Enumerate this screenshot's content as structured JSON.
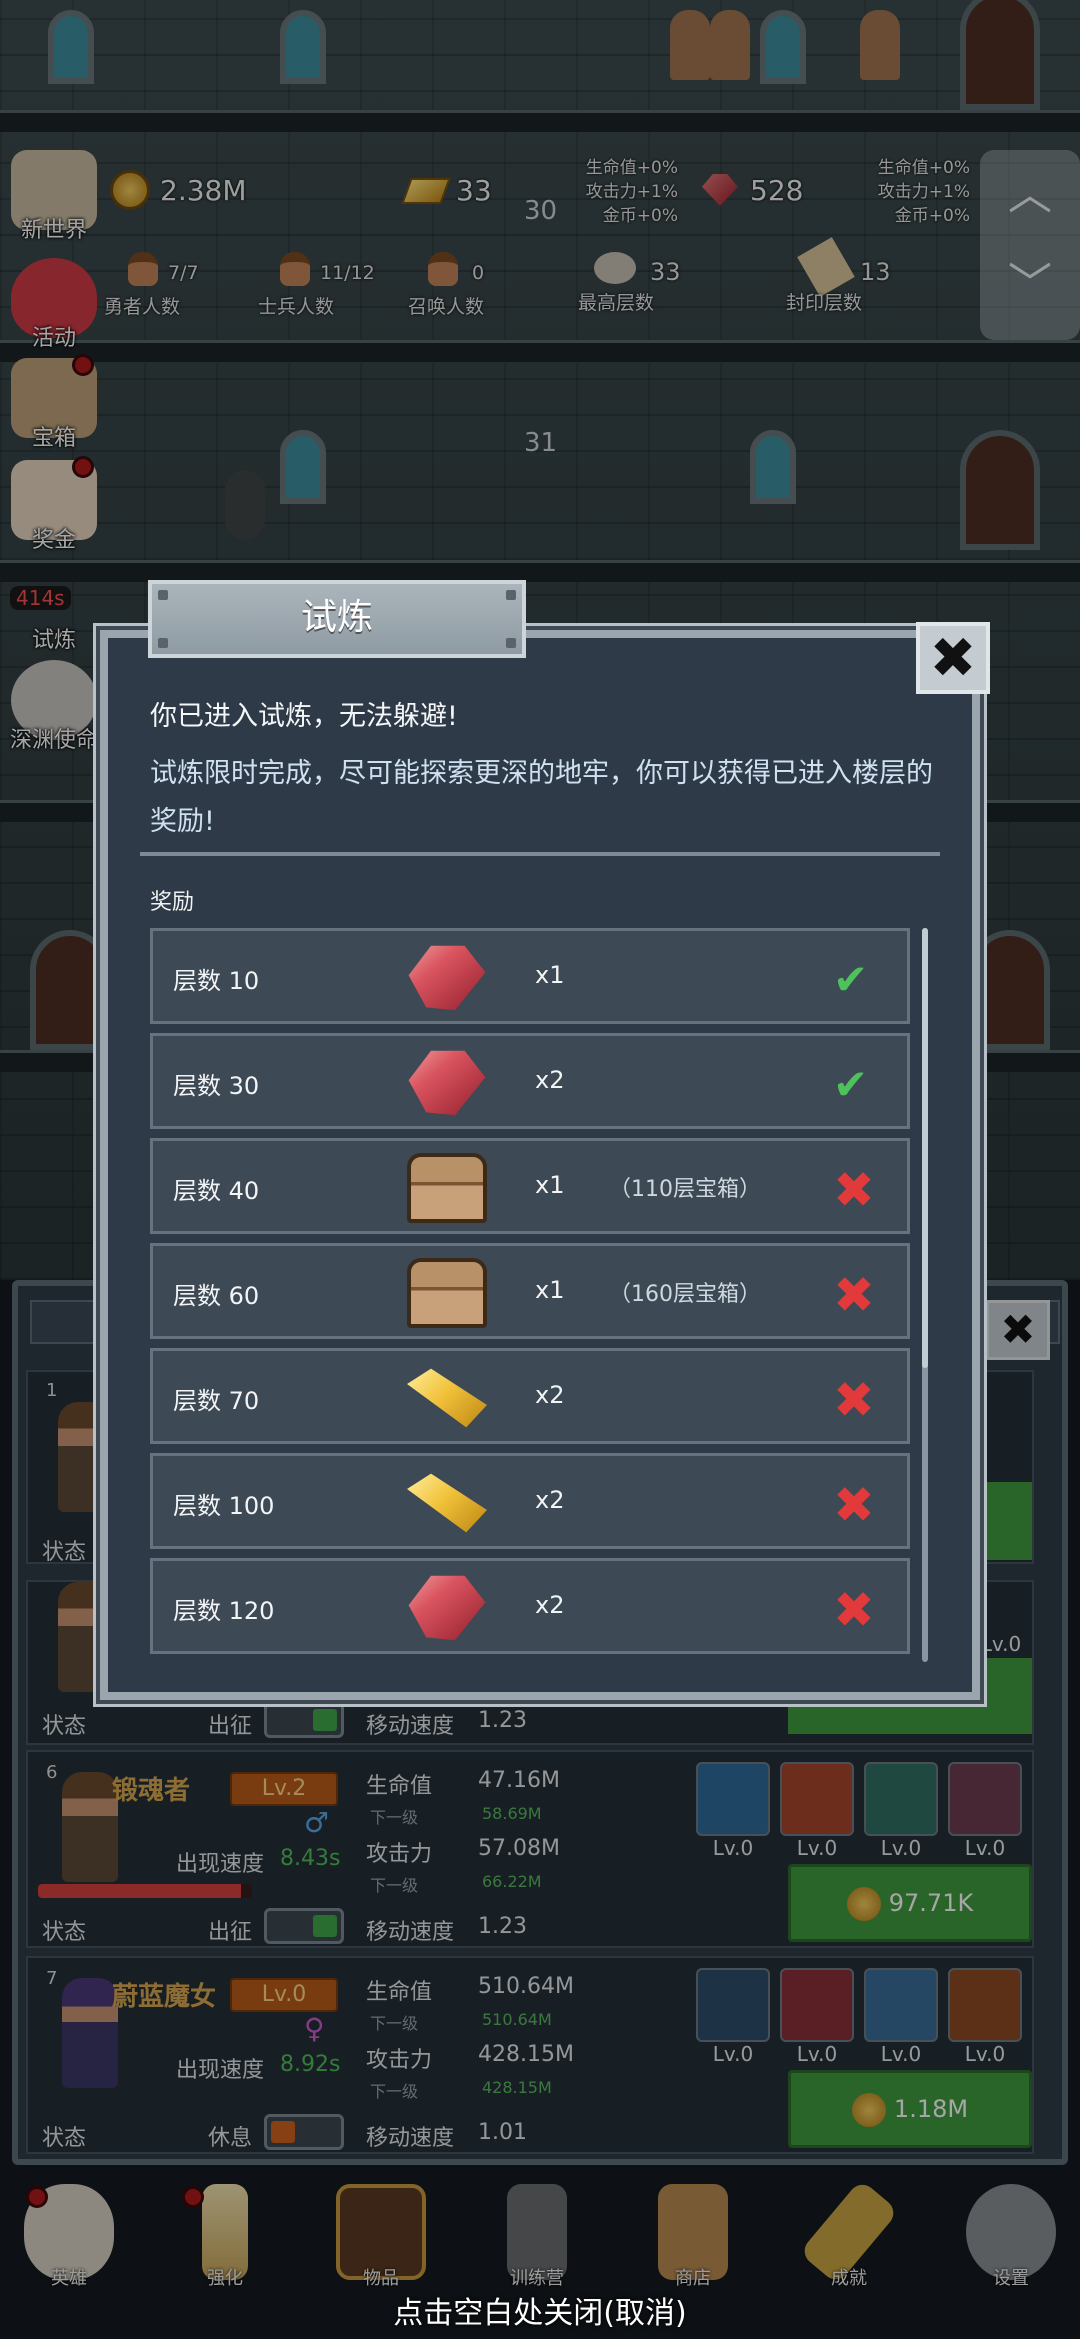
{
  "top_stats": {
    "coins": "2.38M",
    "gold_bars": "33",
    "gold_bonus": [
      "生命值+0%",
      "攻击力+1%",
      "金币+0%"
    ],
    "gems": "528",
    "gem_bonus": [
      "生命值+0%",
      "攻击力+1%",
      "金币+0%"
    ],
    "heroes": {
      "value": "7/7",
      "label": "勇者人数"
    },
    "soldiers": {
      "value": "11/12",
      "label": "士兵人数"
    },
    "summons": {
      "value": "0",
      "label": "召唤人数"
    },
    "max_floor": {
      "value": "33",
      "label": "最高层数"
    },
    "sealed_floor": {
      "value": "13",
      "label": "封印层数"
    }
  },
  "floors": {
    "f30": "30",
    "f31": "31"
  },
  "side_menu": [
    {
      "label": "新世界"
    },
    {
      "label": "活动"
    },
    {
      "label": "宝箱"
    },
    {
      "label": "奖金"
    },
    {
      "label": "试炼"
    },
    {
      "label": "深渊使命"
    }
  ],
  "trial_timer": "414s",
  "modal": {
    "title": "试炼",
    "intro_line1": "你已进入试炼，无法躲避!",
    "intro_line2": "试炼限时完成，尽可能探索更深的地牢，你可以获得已进入楼层的奖励!",
    "rewards_header": "奖励",
    "rewards": [
      {
        "floor": "层数 10",
        "icon": "ruby-icon",
        "qty": "x1",
        "note": "",
        "claimed": true
      },
      {
        "floor": "层数 30",
        "icon": "ruby-icon",
        "qty": "x2",
        "note": "",
        "claimed": true
      },
      {
        "floor": "层数 40",
        "icon": "chest-icon",
        "qty": "x1",
        "note": "（110层宝箱）",
        "claimed": false
      },
      {
        "floor": "层数 60",
        "icon": "chest-icon",
        "qty": "x1",
        "note": "（160层宝箱）",
        "claimed": false
      },
      {
        "floor": "层数 70",
        "icon": "gold-bar-icon",
        "qty": "x2",
        "note": "",
        "claimed": false
      },
      {
        "floor": "层数 100",
        "icon": "gold-bar-icon",
        "qty": "x2",
        "note": "",
        "claimed": false
      },
      {
        "floor": "层数 120",
        "icon": "ruby-icon",
        "qty": "x2",
        "note": "",
        "claimed": false
      }
    ],
    "check_glyph": "✔",
    "cross_glyph": "✖"
  },
  "heroes_panel": {
    "row1": {
      "num": "1",
      "state_label": "状态"
    },
    "row5": {
      "state_label": "状态",
      "deploy_label": "出征",
      "speed_label": "移动速度",
      "speed": "1.23",
      "equip_lv": "Lv.0"
    },
    "row6": {
      "num": "6",
      "name": "锻魂者",
      "level": "Lv.2",
      "spawn_label": "出现速度",
      "spawn": "8.43s",
      "hp_fill": 0.95,
      "hp_label": "生命值",
      "hp": "47.16M",
      "next_label": "下一级",
      "hp_next": "58.69M",
      "atk_label": "攻击力",
      "atk": "57.08M",
      "atk_next": "66.22M",
      "speed_label": "移动速度",
      "speed": "1.23",
      "state_label": "状态",
      "deploy_label": "出征",
      "equip": [
        "Lv.0",
        "Lv.0",
        "Lv.0",
        "Lv.0"
      ],
      "price": "97.71K"
    },
    "row7": {
      "num": "7",
      "name": "蔚蓝魔女",
      "level": "Lv.0",
      "spawn_label": "出现速度",
      "spawn": "8.92s",
      "hp_label": "生命值",
      "hp": "510.64M",
      "next_label": "下一级",
      "hp_next": "510.64M",
      "atk_label": "攻击力",
      "atk": "428.15M",
      "atk_next": "428.15M",
      "speed_label": "移动速度",
      "speed": "1.01",
      "state_label": "状态",
      "rest_label": "休息",
      "equip": [
        "Lv.0",
        "Lv.0",
        "Lv.0",
        "Lv.0"
      ],
      "price": "1.18M"
    }
  },
  "bottom_nav": [
    {
      "label": "英雄"
    },
    {
      "label": "强化"
    },
    {
      "label": "物品"
    },
    {
      "label": "训练营"
    },
    {
      "label": "商店"
    },
    {
      "label": "成就"
    },
    {
      "label": "设置"
    }
  ],
  "close_hint": "点击空白处关闭(取消)",
  "colors": {
    "accent_green": "#3f9a3f",
    "claimed": "#4ec25a",
    "unclaimed": "#e23a3a",
    "modal_bg": "#2e3a47"
  }
}
